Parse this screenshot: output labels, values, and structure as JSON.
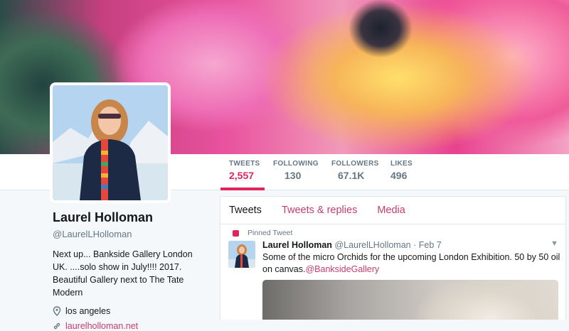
{
  "stats": [
    {
      "label": "TWEETS",
      "value": "2,557"
    },
    {
      "label": "FOLLOWING",
      "value": "130"
    },
    {
      "label": "FOLLOWERS",
      "value": "67.1K"
    },
    {
      "label": "LIKES",
      "value": "496"
    }
  ],
  "profile": {
    "name": "Laurel Holloman",
    "handle": "@LaurelLHolloman",
    "bio": "Next up... Bankside Gallery London UK. ....solo show in July!!!! 2017. Beautiful Gallery next to The Tate Modern",
    "location": "los angeles",
    "website": "laurelholloman.net"
  },
  "timeline": {
    "tabs": [
      "Tweets",
      "Tweets & replies",
      "Media"
    ],
    "pinned_label": "Pinned Tweet",
    "tweet": {
      "name": "Laurel Holloman",
      "handle": "@LaurelLHolloman",
      "separator": "·",
      "date": "Feb 7",
      "text": "Some of the micro Orchids for the upcoming London Exhibition.  50 by 50 oil on canvas.",
      "mention": "@BanksideGallery"
    }
  },
  "colors": {
    "accent": "#e0245e",
    "link": "#c53d6d"
  }
}
